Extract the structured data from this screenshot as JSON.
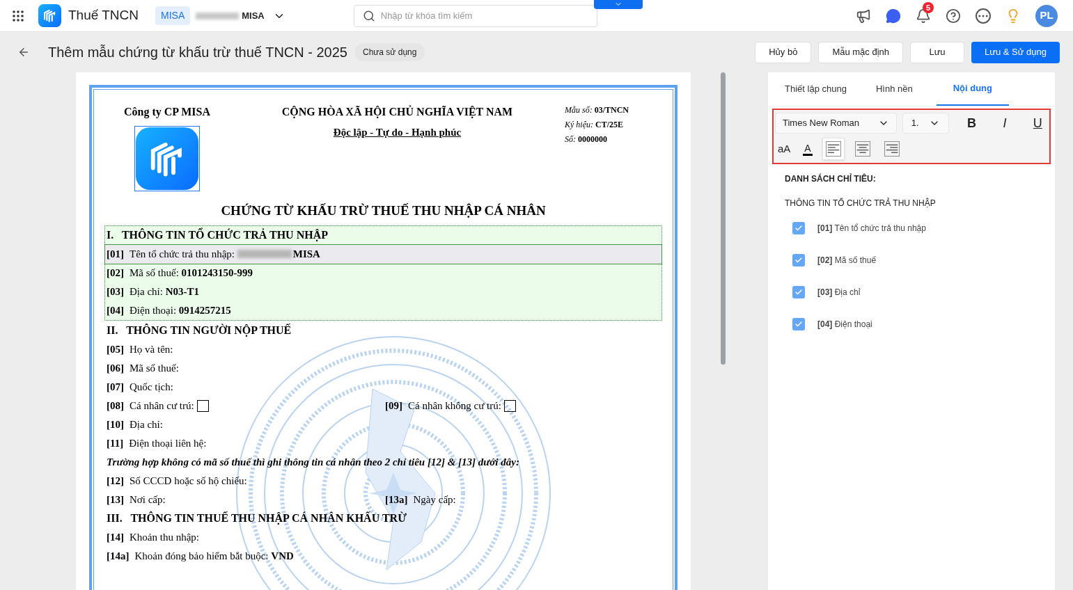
{
  "app": {
    "title": "Thuế TNCN",
    "org_badge": "MISA",
    "org_name": "MISA",
    "notification_count": "5",
    "avatar": "PL"
  },
  "search": {
    "placeholder": "Nhập từ khóa tìm kiếm"
  },
  "page": {
    "title": "Thêm mẫu chứng từ khấu trừ thuế TNCN - 2025",
    "status": "Chưa sử dụng",
    "actions": [
      {
        "label": "Hủy bỏ",
        "primary": false
      },
      {
        "label": "Mẫu mặc định",
        "primary": false
      },
      {
        "label": "Lưu",
        "primary": false
      },
      {
        "label": "Lưu & Sử dụng",
        "primary": true
      }
    ]
  },
  "document": {
    "company": "Công ty CP MISA",
    "nation": "CỘNG HÒA XÃ HỘI CHỦ NGHĨA VIỆT NAM",
    "motto": "Độc lập - Tự do - Hạnh phúc",
    "meta": [
      {
        "label": "Mẫu số:",
        "value": "03/TNCN"
      },
      {
        "label": "Ký hiệu:",
        "value": "CT/25E"
      },
      {
        "label": "Số:",
        "value": "0000000"
      }
    ],
    "heading": "CHỨNG TỪ KHẤU TRỪ THUẾ THU NHẬP CÁ NHÂN",
    "groups": [
      {
        "highlighted": true,
        "rows": [
          {
            "kind": "section",
            "text": "I.   THÔNG TIN TỔ CHỨC TRẢ THU NHẬP"
          },
          {
            "kind": "field",
            "code": "[01]",
            "label": "Tên tổ chức trả thu nhập:",
            "value": "MISA",
            "redacted": true,
            "selected": true
          },
          {
            "kind": "field",
            "code": "[02]",
            "label": "Mã số thuế:",
            "value": "0101243150-999",
            "selected": false
          },
          {
            "kind": "field",
            "code": "[03]",
            "label": "Địa chỉ:",
            "value": "N03-T1",
            "selected": false
          },
          {
            "kind": "field",
            "code": "[04]",
            "label": "Điện thoại:",
            "value": "0914257215",
            "selected": false
          }
        ]
      },
      {
        "highlighted": false,
        "rows": [
          {
            "kind": "section",
            "text": "II.   THÔNG TIN NGƯỜI NỘP THUẾ"
          },
          {
            "kind": "field",
            "code": "[05]",
            "label": "Họ và tên:"
          },
          {
            "kind": "field",
            "code": "[06]",
            "label": "Mã số thuế:"
          },
          {
            "kind": "field",
            "code": "[07]",
            "label": "Quốc tịch:"
          },
          {
            "kind": "pair",
            "items": [
              {
                "kind": "checkbox",
                "code": "[08]",
                "label": "Cá nhân cư trú:",
                "checked": false
              },
              {
                "kind": "checkbox",
                "code": "[09]",
                "label": "Cá nhân không cư trú:",
                "checked": false
              }
            ]
          },
          {
            "kind": "field",
            "code": "[10]",
            "label": "Địa chỉ:"
          },
          {
            "kind": "field",
            "code": "[11]",
            "label": "Điện thoại liên hệ:"
          },
          {
            "kind": "note",
            "text": "Trường hợp không có mã số thuế thì ghi thông tin cá nhân theo 2 chỉ tiêu [12] & [13] dưới đây:"
          },
          {
            "kind": "field",
            "code": "[12]",
            "label": "Số CCCD hoặc số hộ chiếu:"
          },
          {
            "kind": "pair",
            "items": [
              {
                "kind": "text",
                "code": "[13]",
                "label": "Nơi cấp:"
              },
              {
                "kind": "text",
                "code": "[13a]",
                "label": "Ngày cấp:"
              }
            ]
          },
          {
            "kind": "section",
            "text": "III.   THÔNG TIN THUẾ THU NHẬP CÁ NHÂN KHẤU TRỪ"
          },
          {
            "kind": "field",
            "code": "[14]",
            "label": "Khoản thu nhập:"
          },
          {
            "kind": "field",
            "code": "[14a]",
            "label": "Khoản đóng bảo hiểm bắt buộc:",
            "value": "VND"
          }
        ]
      }
    ]
  },
  "panel": {
    "tabs": [
      {
        "label": "Thiết lập chung",
        "selected": false
      },
      {
        "label": "Hình nền",
        "selected": false
      },
      {
        "label": "Nội dung",
        "selected": true
      }
    ],
    "toolbar": {
      "font": "Times New Roman",
      "size": "1.",
      "case_toggle": "aA",
      "color_letter": "A",
      "underline_letter": "U",
      "bold_letter": "B",
      "italic_letter": "I",
      "alignments": [
        {
          "kind": "left",
          "selected": true
        },
        {
          "kind": "center",
          "selected": false
        },
        {
          "kind": "right",
          "selected": false
        }
      ]
    },
    "list_title": "DANH SÁCH CHỈ TIÊU:",
    "group_title": "THÔNG TIN TỔ CHỨC TRẢ THU NHẬP",
    "items": [
      {
        "code": "[01]",
        "label": "Tên tổ chức trả thu nhập",
        "checked": true
      },
      {
        "code": "[02]",
        "label": "Mã số thuế",
        "checked": true
      },
      {
        "code": "[03]",
        "label": "Địa chỉ",
        "checked": true
      },
      {
        "code": "[04]",
        "label": "Điện thoại",
        "checked": true
      }
    ]
  }
}
